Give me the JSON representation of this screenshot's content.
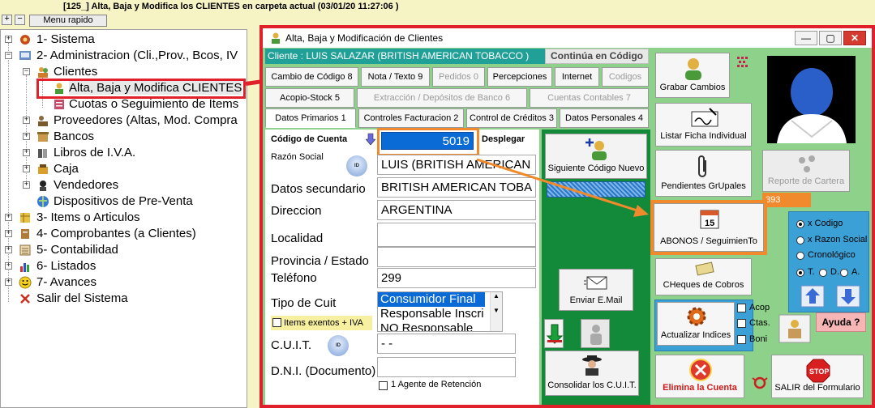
{
  "app": {
    "title": "[125_] Alta, Baja y Modifica los CLIENTES en carpeta actual (03/01/20 11:27:06  )",
    "menu_rapido": "Menu rapido"
  },
  "toolbar": {
    "expand": "+",
    "collapse": "−"
  },
  "tree": {
    "items": [
      {
        "label": "1- Sistema",
        "icon": "gear-icon"
      },
      {
        "label": "2- Administracion (Cli.,Prov., Bcos, IV",
        "icon": "admin-icon"
      },
      {
        "label": "Clientes",
        "icon": "users-icon"
      },
      {
        "label": "Alta, Baja y Modifica CLIENTES",
        "icon": "user-edit-icon"
      },
      {
        "label": "Cuotas o Seguimiento de Items",
        "icon": "list-icon"
      },
      {
        "label": "Proveedores (Altas, Mod. Compra",
        "icon": "supplier-icon"
      },
      {
        "label": "Bancos",
        "icon": "bank-icon"
      },
      {
        "label": "Libros de I.V.A.",
        "icon": "books-icon"
      },
      {
        "label": "Caja",
        "icon": "cash-icon"
      },
      {
        "label": "Vendedores",
        "icon": "seller-icon"
      },
      {
        "label": "Dispositivos de Pre-Venta",
        "icon": "globe-icon"
      },
      {
        "label": "3- Items o Articulos",
        "icon": "items-icon"
      },
      {
        "label": "4- Comprobantes (a Clientes)",
        "icon": "receipt-icon"
      },
      {
        "label": "5- Contabilidad",
        "icon": "ledger-icon"
      },
      {
        "label": "6- Listados",
        "icon": "chart-icon"
      },
      {
        "label": "7- Avances",
        "icon": "smiley-icon"
      },
      {
        "label": "Salir del Sistema",
        "icon": "exit-icon"
      }
    ]
  },
  "window": {
    "title": "Alta, Baja y Modificación de Clientes",
    "client": "Cliente : LUIS SALAZAR (BRITISH AMERICAN TOBACCO )",
    "continua": "Continúa en Código",
    "tabs_row1": [
      "Cambio de Código 8",
      "Nota / Texto 9",
      "Pedidos 0",
      "Percepciones",
      "Internet",
      "Codigos"
    ],
    "tabs_row2": [
      "Acopio-Stock 5",
      "Extracción / Depósitos de Banco 6",
      "Cuentas Contables 7"
    ],
    "tabs_row3": [
      "Datos Primarios 1",
      "Controles Facturacion 2",
      "Control de Créditos 3",
      "Datos Personales 4"
    ],
    "form": {
      "codigo_label": "Código de Cuenta",
      "codigo_value": "5019",
      "desplegar": "Desplegar",
      "razon_label": "Razón Social",
      "razon_value": "LUIS  (BRITISH AMERICAN",
      "secundarios_label": "Datos secundario",
      "secundarios_value": "BRITISH AMERICAN TOBA",
      "direccion_label": "Direccion",
      "direccion_value": "ARGENTINA",
      "localidad_label": "Localidad",
      "localidad_value": "",
      "provincia_label": "Provincia / Estado",
      "provincia_value": "",
      "telefono_label": "Teléfono",
      "telefono_value": "299",
      "tipo_cuit_label": "Tipo de Cuit",
      "tipo_cuit_options": [
        "Consumidor Final",
        "Responsable Inscri",
        "NO Responsable"
      ],
      "items_exentos": "Items exentos + IVA",
      "cuit_label": "C.U.I.T.",
      "cuit_value": "  -         -",
      "dni_label": "D.N.I. (Documento)",
      "dni_value": "",
      "agente": "1 Agente de Retención",
      "id_icon_text": "ID"
    },
    "mid_buttons": {
      "siguiente": "Siguiente Código Nuevo",
      "enviar": "Enviar E.Mail",
      "consolidar": "Consolidar los C.U.I.T."
    },
    "right_buttons": {
      "grabar": "Grabar Cambios",
      "listar": "Listar Ficha Individual",
      "reporte": "Reporte de Cartera",
      "pendientes": "Pendientes GrUpales",
      "badge": "393",
      "abonos": "ABONOS / SeguimienTo",
      "cheques": "CHeques de Cobros",
      "actualizar": "Actualizar Indices",
      "elimina": "Elimina la Cuenta",
      "salir": "SALIR del Formulario",
      "ayuda": "Ayuda ?"
    },
    "order": {
      "x_codigo": "x Codigo",
      "x_razon": "x Razon Social",
      "cronologico": "Cronológico",
      "t": "T.",
      "d": "D.",
      "a": "A."
    },
    "checks": {
      "acop": "Acop",
      "ctas": "Ctas.",
      "boni": "Boni"
    }
  },
  "colors": {
    "accent_red": "#e0202a",
    "accent_orange": "#f08a2c",
    "green": "#8ed18b",
    "dark_green": "#138a3a",
    "teal": "#21a098",
    "selection_blue": "#0a6bd6"
  }
}
